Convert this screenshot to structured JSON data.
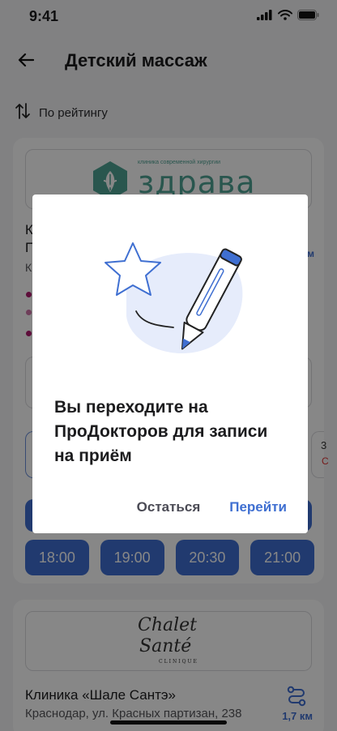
{
  "status_bar": {
    "time": "9:41"
  },
  "header": {
    "title": "Детский массаж"
  },
  "sort": {
    "label": "По рейтингу"
  },
  "clinic_1": {
    "logo_caption": "клиника современной хирургии",
    "logo_text": "здрава",
    "partial_line_1": "К",
    "partial_line_2": "П",
    "partial_line_3": "К",
    "partial_km": "м",
    "partial_right_top": "3",
    "partial_right_bottom": "С",
    "slots": [
      "18:00",
      "19:00",
      "20:30",
      "21:00"
    ]
  },
  "clinic_2": {
    "logo_line1": "Chalet",
    "logo_line2": "Santé",
    "logo_line3": "CLINIQUE",
    "name": "Клиника «Шале Сантэ»",
    "address": "Краснодар, ул. Красных партизан, 238",
    "distance": "1,7 км"
  },
  "dialog": {
    "message": "Вы переходите на ПроДокторов для записи на приём",
    "stay_label": "Остаться",
    "go_label": "Перейти"
  },
  "colors": {
    "accent": "#3f6fd1",
    "logo_green": "#4fa294",
    "dot_magenta": "#b0196f"
  }
}
